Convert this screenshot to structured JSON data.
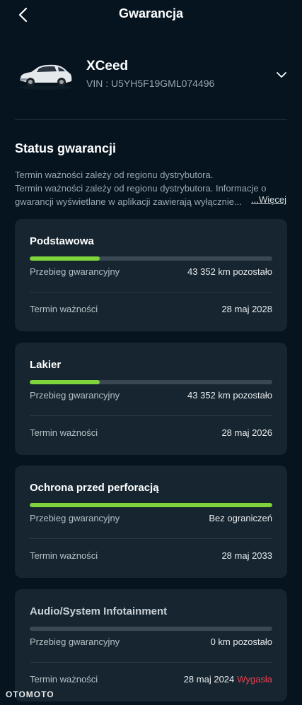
{
  "header": {
    "title": "Gwarancja"
  },
  "vehicle": {
    "name": "XCeed",
    "vin": "VIN : U5YH5F19GML074496"
  },
  "status": {
    "title": "Status gwarancji",
    "desc_line1": "Termin ważności zależy od regionu dystrybutora.",
    "desc_line2": "Termin ważności zależy od regionu dystrybutora. Informacje o",
    "desc_line3": "gwarancji wyświetlane w aplikacji zawierają wyłącznie...",
    "more": "...Więcej"
  },
  "cards": [
    {
      "title": "Podstawowa",
      "progress": 0.29,
      "mileage_label": "Przebieg gwarancyjny",
      "mileage_value": "43 352 km pozostało",
      "expiry_label": "Termin ważności",
      "expiry_value": "28 maj 2028",
      "expired_label": ""
    },
    {
      "title": "Lakier",
      "progress": 0.29,
      "mileage_label": "Przebieg gwarancyjny",
      "mileage_value": "43 352 km pozostało",
      "expiry_label": "Termin ważności",
      "expiry_value": "28 maj 2026",
      "expired_label": ""
    },
    {
      "title": "Ochrona przed perforacją",
      "progress": 1.0,
      "mileage_label": "Przebieg gwarancyjny",
      "mileage_value": "Bez ograniczeń",
      "expiry_label": "Termin ważności",
      "expiry_value": "28 maj 2033",
      "expired_label": ""
    },
    {
      "title": "Audio/System Infotainment",
      "progress": 0.0,
      "mileage_label": "Przebieg gwarancyjny",
      "mileage_value": "0 km pozostało",
      "expiry_label": "Termin ważności",
      "expiry_value": "28 maj 2024",
      "expired_label": "Wygasła"
    }
  ],
  "watermark": "OTOMOTO",
  "colors": {
    "background": "#05141f",
    "card": "#162530",
    "progress": "#7fd33b",
    "expired": "#e8414e"
  },
  "icons": {
    "back": "chevron-left-icon",
    "expand": "chevron-down-icon",
    "vehicle": "car-image"
  }
}
